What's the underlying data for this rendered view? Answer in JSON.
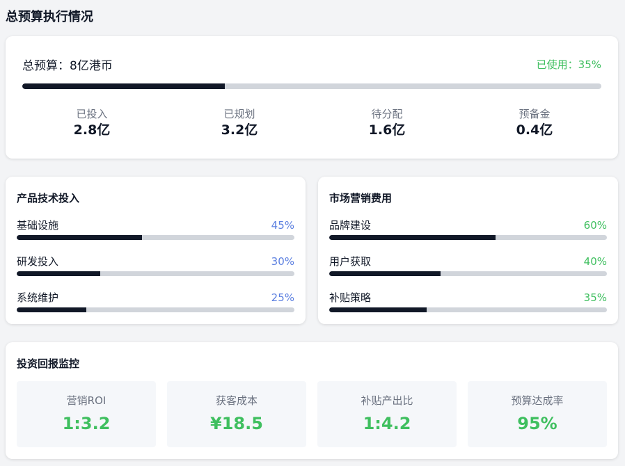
{
  "page_title": "总预算执行情况",
  "colors": {
    "accent_green": "#3fbf5f",
    "accent_blue": "#5b7fe0",
    "bar_dark": "#111827",
    "bar_track": "#d1d5db"
  },
  "total": {
    "label": "总预算：8亿港币",
    "used_text": "已使用：35%",
    "used_fraction": 0.35,
    "stats": [
      {
        "label": "已投入",
        "value": "2.8亿"
      },
      {
        "label": "已规划",
        "value": "3.2亿"
      },
      {
        "label": "待分配",
        "value": "1.6亿"
      },
      {
        "label": "预备金",
        "value": "0.4亿"
      }
    ]
  },
  "product_tech": {
    "title": "产品技术投入",
    "items": [
      {
        "label": "基础设施",
        "percent_text": "45%",
        "fraction": 0.45
      },
      {
        "label": "研发投入",
        "percent_text": "30%",
        "fraction": 0.3
      },
      {
        "label": "系统维护",
        "percent_text": "25%",
        "fraction": 0.25
      }
    ]
  },
  "marketing": {
    "title": "市场营销费用",
    "items": [
      {
        "label": "品牌建设",
        "percent_text": "60%",
        "fraction": 0.6
      },
      {
        "label": "用户获取",
        "percent_text": "40%",
        "fraction": 0.4
      },
      {
        "label": "补贴策略",
        "percent_text": "35%",
        "fraction": 0.35
      }
    ]
  },
  "roi": {
    "title": "投资回报监控",
    "tiles": [
      {
        "label": "营销ROI",
        "value": "1:3.2"
      },
      {
        "label": "获客成本",
        "value": "¥18.5"
      },
      {
        "label": "补贴产出比",
        "value": "1:4.2"
      },
      {
        "label": "预算达成率",
        "value": "95%"
      }
    ]
  }
}
